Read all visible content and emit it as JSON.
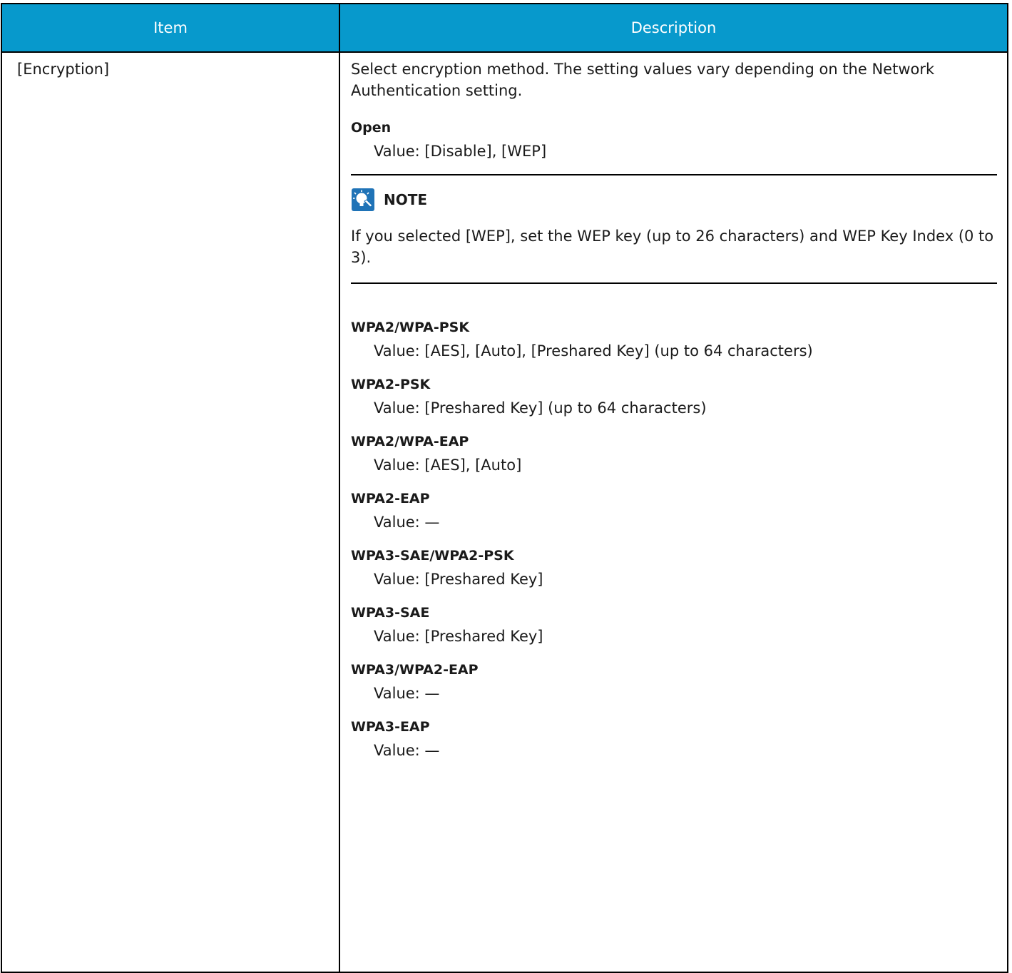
{
  "table": {
    "header": {
      "item": "Item",
      "description": "Description"
    },
    "row": {
      "item": "[Encryption]",
      "intro": "Select encryption method. The setting values vary depending on the Network Authentication setting.",
      "open": {
        "name": "Open",
        "value": "Value: [Disable], [WEP]"
      },
      "note": {
        "title": "NOTE",
        "icon": "lightbulb-note-icon",
        "text": "If you selected [WEP], set the WEP key (up to 26 characters) and WEP Key Index (0 to 3)."
      },
      "options": [
        {
          "name": "WPA2/WPA-PSK",
          "value": "Value: [AES], [Auto], [Preshared Key] (up to 64 characters)"
        },
        {
          "name": "WPA2-PSK",
          "value": "Value: [Preshared Key] (up to 64 characters)"
        },
        {
          "name": "WPA2/WPA-EAP",
          "value": "Value: [AES], [Auto]"
        },
        {
          "name": "WPA2-EAP",
          "value": "Value: —"
        },
        {
          "name": "WPA3-SAE/WPA2-PSK",
          "value": "Value: [Preshared Key]"
        },
        {
          "name": "WPA3-SAE",
          "value": "Value: [Preshared Key]"
        },
        {
          "name": "WPA3/WPA2-EAP",
          "value": "Value: —"
        },
        {
          "name": "WPA3-EAP",
          "value": "Value: —"
        }
      ]
    }
  },
  "colors": {
    "header_bg": "#0799cc",
    "header_text": "#ffffff",
    "icon_blue": "#1f73b7"
  }
}
